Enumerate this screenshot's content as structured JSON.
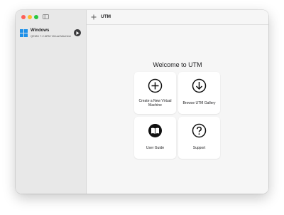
{
  "sidebar": {
    "vm": {
      "name": "Windows",
      "description": "QEMU 7.2 ARM Virtual Machine"
    }
  },
  "toolbar": {
    "title": "UTM"
  },
  "main": {
    "welcome": "Welcome to UTM",
    "cards": [
      {
        "label": "Create a New Virtual Machine",
        "icon": "plus-circle-icon"
      },
      {
        "label": "Browse UTM Gallery",
        "icon": "download-circle-icon"
      },
      {
        "label": "User Guide",
        "icon": "book-icon"
      },
      {
        "label": "Support",
        "icon": "question-circle-icon"
      }
    ]
  },
  "colors": {
    "close": "#fe5f57",
    "minimize": "#febc2e",
    "zoom": "#28c840",
    "windows_logo": "#1e90e8"
  }
}
